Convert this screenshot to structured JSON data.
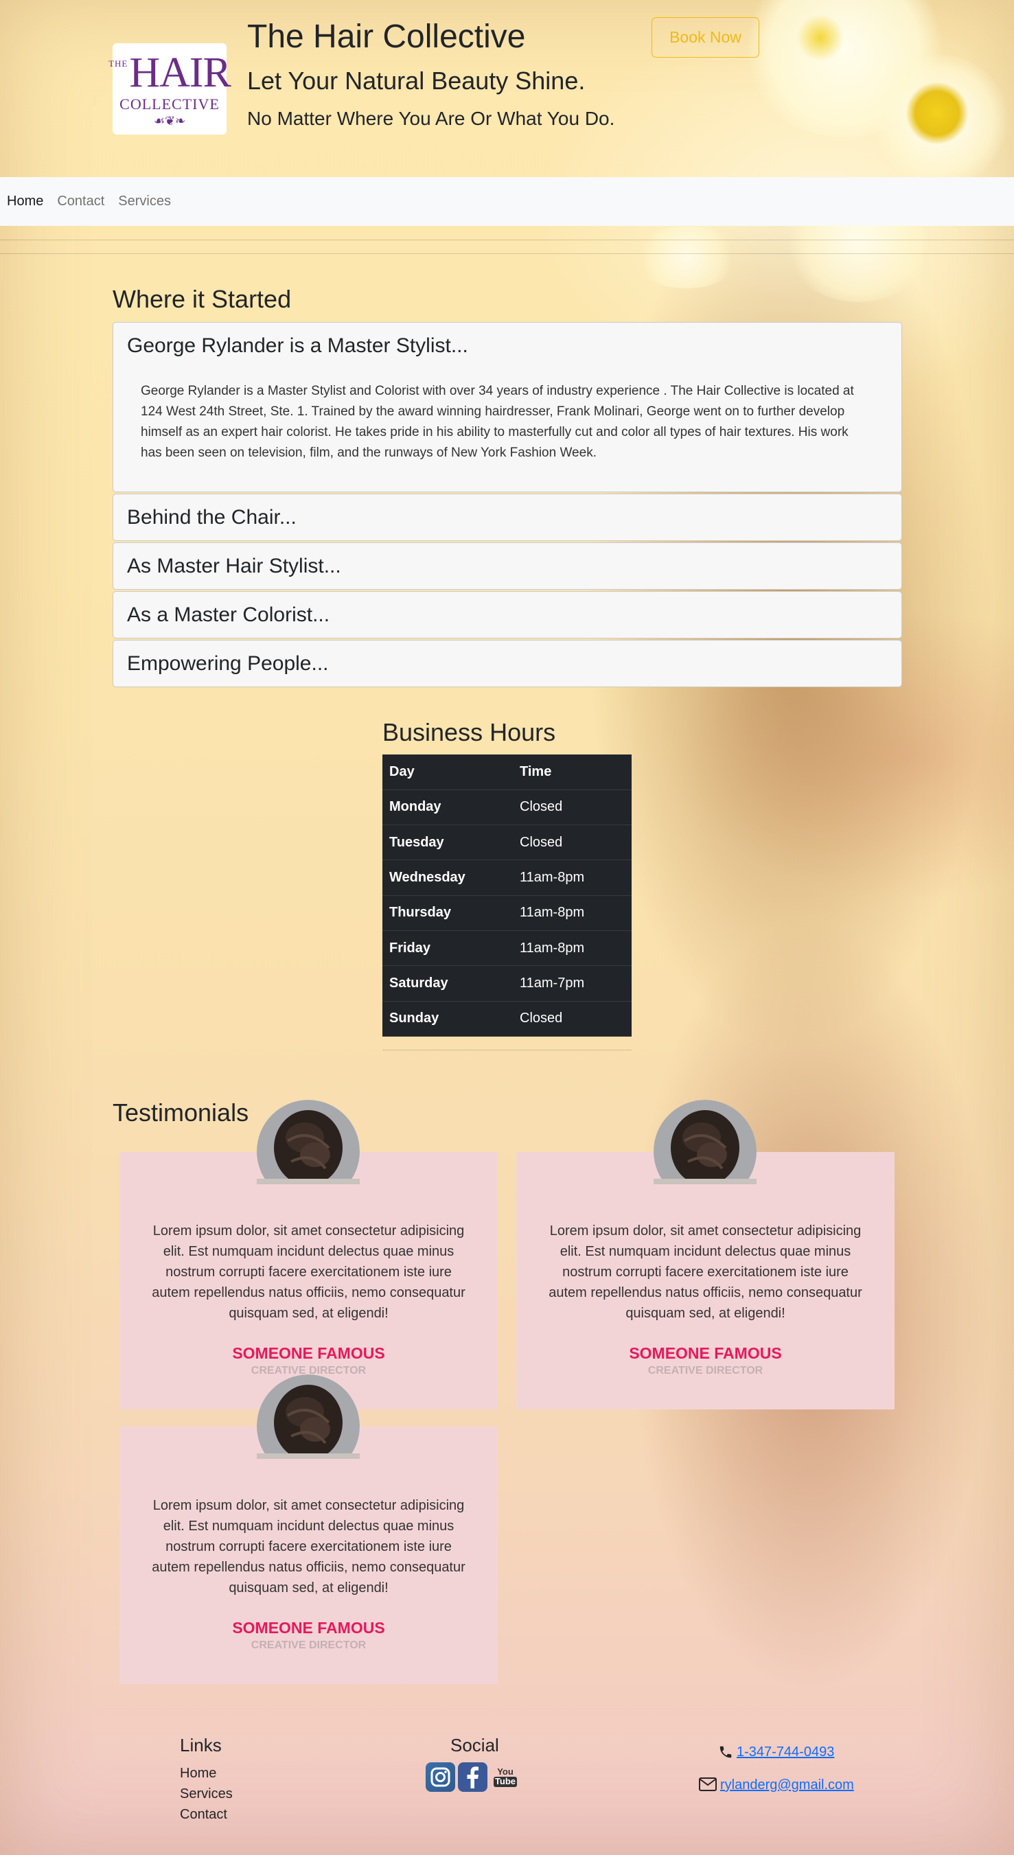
{
  "header": {
    "logo": {
      "the": "THE",
      "hair": "HAIR",
      "collective": "COLLECTIVE",
      "ornament": "☙❦❧"
    },
    "title": "The Hair Collective",
    "tagline": "Let Your Natural Beauty Shine.",
    "subtagline": "No Matter Where You Are Or What You Do.",
    "book_label": "Book Now",
    "accent_color": "#f0b91b"
  },
  "nav": {
    "items": [
      "Home",
      "Contact",
      "Services"
    ],
    "active": "Home"
  },
  "about": {
    "title": "Where it Started",
    "items": [
      {
        "heading": "George Rylander is a Master Stylist...",
        "body": "George Rylander is a Master Stylist and Colorist with over 34 years of industry experience . The Hair Collective is located at 124 West 24th Street, Ste. 1. Trained by the award winning hairdresser, Frank Molinari, George went on to further develop himself as an expert hair colorist. He takes pride in his ability to masterfully cut and color all types of hair textures. His work has been seen on television, film, and the runways of New York Fashion Week."
      },
      {
        "heading": "Behind the Chair..."
      },
      {
        "heading": "As Master Hair Stylist..."
      },
      {
        "heading": "As a Master Colorist..."
      },
      {
        "heading": "Empowering People..."
      }
    ]
  },
  "hours": {
    "title": "Business Hours",
    "headers": [
      "Day",
      "Time"
    ],
    "rows": [
      [
        "Monday",
        "Closed"
      ],
      [
        "Tuesday",
        "Closed"
      ],
      [
        "Wednesday",
        "11am-8pm"
      ],
      [
        "Thursday",
        "11am-8pm"
      ],
      [
        "Friday",
        "11am-8pm"
      ],
      [
        "Saturday",
        "11am-7pm"
      ],
      [
        "Sunday",
        "Closed"
      ]
    ]
  },
  "testimonials": {
    "title": "Testimonials",
    "cards": [
      {
        "quote": "Lorem ipsum dolor, sit amet consectetur adipisicing elit. Est numquam incidunt delectus quae minus nostrum corrupti facere exercitationem iste iure autem repellendus natus officiis, nemo consequatur quisquam sed, at eligendi!",
        "name": "SOMEONE FAMOUS",
        "role": "CREATIVE DIRECTOR"
      },
      {
        "quote": "Lorem ipsum dolor, sit amet consectetur adipisicing elit. Est numquam incidunt delectus quae minus nostrum corrupti facere exercitationem iste iure autem repellendus natus officiis, nemo consequatur quisquam sed, at eligendi!",
        "name": "SOMEONE FAMOUS",
        "role": "CREATIVE DIRECTOR"
      },
      {
        "quote": "Lorem ipsum dolor, sit amet consectetur adipisicing elit. Est numquam incidunt delectus quae minus nostrum corrupti facere exercitationem iste iure autem repellendus natus officiis, nemo consequatur quisquam sed, at eligendi!",
        "name": "SOMEONE FAMOUS",
        "role": "CREATIVE DIRECTOR"
      }
    ],
    "name_color": "#e5195d"
  },
  "footer": {
    "links_title": "Links",
    "links": [
      "Home",
      "Services",
      "Contact"
    ],
    "social_title": "Social",
    "social_icons": [
      "instagram-icon",
      "facebook-icon",
      "youtube-icon"
    ],
    "youtube_you": "You",
    "youtube_tube": "Tube",
    "phone": "1-347-744-0493",
    "email": "rylanderg@gmail.com",
    "link_color": "#0d6efd"
  }
}
